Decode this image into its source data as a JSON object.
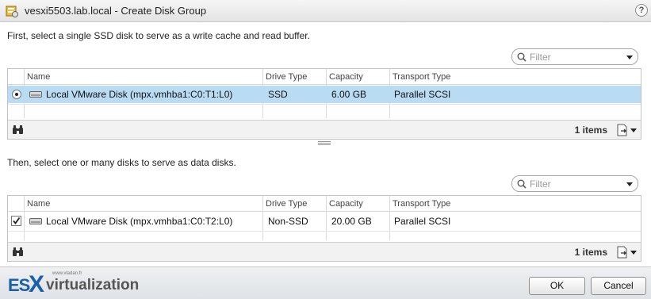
{
  "window": {
    "title": "vesxi5503.lab.local - Create Disk Group",
    "help_label": "?"
  },
  "cache_section": {
    "instruction": "First, select a single SSD disk to serve as a write cache and read buffer.",
    "filter_placeholder": "Filter",
    "columns": [
      "Name",
      "Drive Type",
      "Capacity",
      "Transport Type"
    ],
    "rows": [
      {
        "name": "Local VMware Disk (mpx.vmhba1:C0:T1:L0)",
        "drive_type": "SSD",
        "capacity": "6.00 GB",
        "transport": "Parallel SCSI",
        "selected": true
      }
    ],
    "item_count": "1 items"
  },
  "data_section": {
    "instruction": "Then, select one or many disks to serve as data disks.",
    "filter_placeholder": "Filter",
    "columns": [
      "Name",
      "Drive Type",
      "Capacity",
      "Transport Type"
    ],
    "rows": [
      {
        "name": "Local VMware Disk (mpx.vmhba1:C0:T2:L0)",
        "drive_type": "Non-SSD",
        "capacity": "20.00 GB",
        "transport": "Parallel SCSI",
        "checked": true
      }
    ],
    "item_count": "1 items"
  },
  "watermark": {
    "es": "ES",
    "x": "X",
    "word": "virtualization",
    "site": "www.vladan.fr"
  },
  "buttons": {
    "ok": "OK",
    "cancel": "Cancel"
  },
  "colors": {
    "selected_row": "#b9dcf3",
    "brand_blue": "#1a5fa8"
  }
}
